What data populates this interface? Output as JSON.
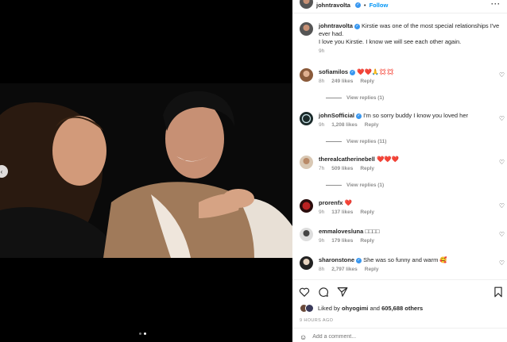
{
  "post": {
    "author": "johntravolta",
    "follow_label": "Follow",
    "separator": "•",
    "more_label": "···",
    "caption_line1": "Kirstie was one of the most special relationships I've ever had.",
    "caption_line2": "I love you Kirstie. I know we will see each other again.",
    "caption_time": "9h",
    "liked_by_prefix": "Liked by",
    "liked_by_user": "ohyogimi",
    "liked_by_and": "and",
    "likes_count": "605,688 others",
    "time_ago": "9 HOURS AGO",
    "add_comment_placeholder": "Add a comment..."
  },
  "comments": [
    {
      "user": "sofiamilos",
      "text": "❤️❤️🙏💢💢",
      "time": "8h",
      "likes": "249 likes",
      "reply": "Reply",
      "view_replies": "View replies (1)"
    },
    {
      "user": "johnSofficial",
      "text": "I'm so sorry buddy I know you loved her",
      "time": "9h",
      "likes": "1,208 likes",
      "reply": "Reply",
      "view_replies": "View replies (11)"
    },
    {
      "user": "therealcatherinebell",
      "text": "❤️❤️❤️",
      "time": "7h",
      "likes": "509 likes",
      "reply": "Reply",
      "view_replies": "View replies (1)"
    },
    {
      "user": "prorenfx",
      "text": "❤️",
      "time": "9h",
      "likes": "137 likes",
      "reply": "Reply"
    },
    {
      "user": "emmalovesluna",
      "text": "□□□□",
      "time": "9h",
      "likes": "179 likes",
      "reply": "Reply"
    },
    {
      "user": "sharonstone",
      "text": "She was so funny and warm 🥰",
      "time": "8h",
      "likes": "2,797 likes",
      "reply": "Reply"
    }
  ],
  "icons": {
    "like": "heart-icon",
    "comment": "comment-icon",
    "share": "share-icon",
    "save": "bookmark-icon",
    "emoji": "emoji-icon"
  },
  "colors": {
    "link_blue": "#0095f6",
    "verified_blue": "#3897f0",
    "heart_red": "#ed4956",
    "muted": "#8e8e8e"
  }
}
